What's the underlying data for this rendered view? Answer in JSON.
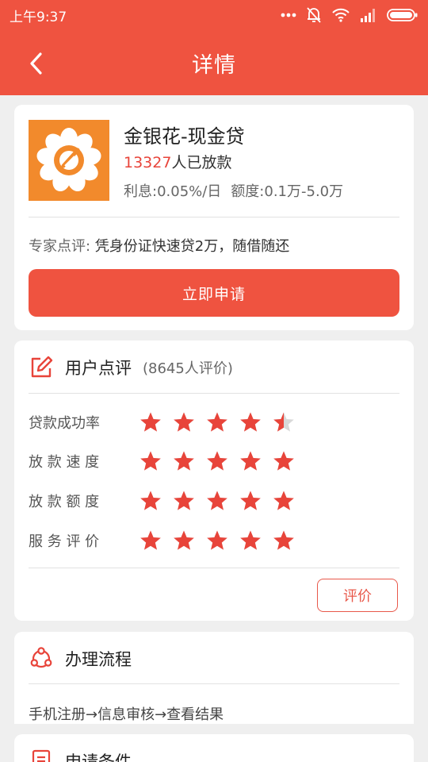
{
  "status_bar": {
    "time": "上午9:37",
    "icons": [
      "more-dots-icon",
      "mute-bell-icon",
      "wifi-icon",
      "signal-icon",
      "battery-icon"
    ]
  },
  "header": {
    "back_icon": "chevron-left-icon",
    "title": "详情"
  },
  "product": {
    "name": "金银花-现金贷",
    "count": "13327",
    "count_suffix": "人已放款",
    "rate": "利息:0.05%/日",
    "amount": "额度:0.1万-5.0万",
    "expert_label": "专家点评:",
    "expert_text": " 凭身份证快速贷2万，随借随还",
    "apply_label": "立即申请"
  },
  "reviews": {
    "title": "用户点评",
    "count_text": "(8645人评价)",
    "rows": [
      {
        "label": "贷款成功率",
        "stars": 4.5
      },
      {
        "label": "放 款 速 度",
        "stars": 5
      },
      {
        "label": "放 款 额 度",
        "stars": 5
      },
      {
        "label": "服 务 评 价",
        "stars": 5
      }
    ],
    "button_label": "评价"
  },
  "process": {
    "title": "办理流程",
    "text": "手机注册→信息审核→查看结果"
  },
  "conditions": {
    "title": "申请条件"
  },
  "colors": {
    "brand": "#ef5340",
    "star": "#e8443a",
    "star_empty": "#d8d8d8",
    "logo_bg": "#f28a2c"
  }
}
